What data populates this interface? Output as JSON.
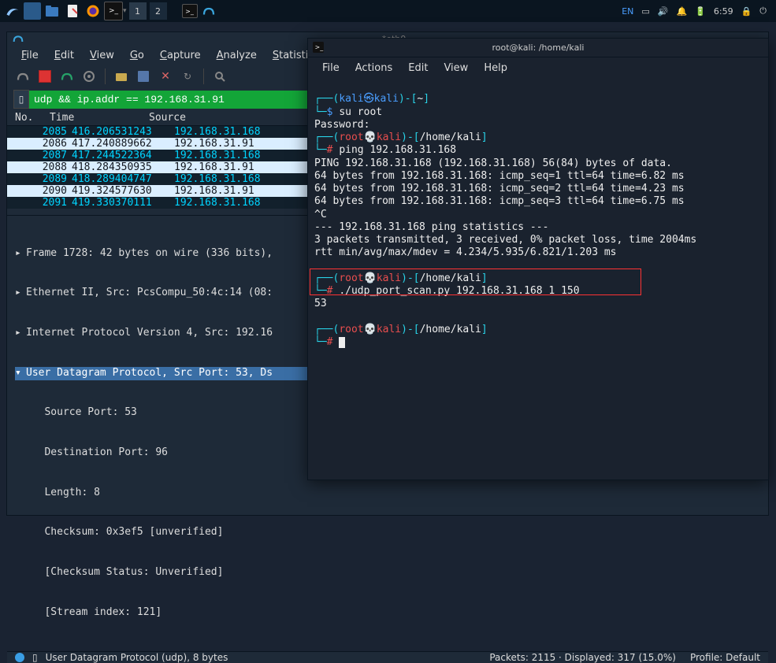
{
  "taskbar": {
    "workspaces": [
      "1",
      "2"
    ],
    "lang": "EN",
    "time": "6:59"
  },
  "wireshark": {
    "interface_title": "*eth0",
    "menu": [
      "File",
      "Edit",
      "View",
      "Go",
      "Capture",
      "Analyze",
      "Statistics"
    ],
    "filter": "udp && ip.addr == 192.168.31.91",
    "columns": {
      "no": "No.",
      "time": "Time",
      "source": "Source"
    },
    "rows": [
      {
        "no": "2085",
        "time": "416.206531243",
        "src": "192.168.31.168",
        "cls": "row-dark"
      },
      {
        "no": "2086",
        "time": "417.240889662",
        "src": "192.168.31.91",
        "cls": "row-light"
      },
      {
        "no": "2087",
        "time": "417.244522364",
        "src": "192.168.31.168",
        "cls": "row-dark"
      },
      {
        "no": "2088",
        "time": "418.284350935",
        "src": "192.168.31.91",
        "cls": "row-light"
      },
      {
        "no": "2089",
        "time": "418.289404747",
        "src": "192.168.31.168",
        "cls": "row-dark"
      },
      {
        "no": "2090",
        "time": "419.324577630",
        "src": "192.168.31.91",
        "cls": "row-light"
      },
      {
        "no": "2091",
        "time": "419.330370111",
        "src": "192.168.31.168",
        "cls": "row-dark"
      }
    ],
    "details": {
      "l0": "Frame 1728: 42 bytes on wire (336 bits),",
      "l1": "Ethernet II, Src: PcsCompu_50:4c:14 (08:",
      "l2": "Internet Protocol Version 4, Src: 192.16",
      "l3": "User Datagram Protocol, Src Port: 53, Ds",
      "l4": "   Source Port: 53",
      "l5": "   Destination Port: 96",
      "l6": "   Length: 8",
      "l7": "   Checksum: 0x3ef5 [unverified]",
      "l8": "   [Checksum Status: Unverified]",
      "l9": "   [Stream index: 121]"
    },
    "status": {
      "left": "User Datagram Protocol (udp), 8 bytes",
      "packets": "Packets: 2115 · Displayed: 317 (15.0%)",
      "profile": "Profile: Default"
    }
  },
  "terminal": {
    "title": "root@kali: /home/kali",
    "menu": [
      "File",
      "Actions",
      "Edit",
      "View",
      "Help"
    ],
    "prompt1_userhost": "kali㉿kali",
    "prompt1_path": "~",
    "cmd1": "su root",
    "password_label": "Password:",
    "prompt2_user": "root",
    "prompt2_host": "kali",
    "prompt2_path": "/home/kali",
    "cmd2": "ping 192.168.31.168",
    "ping_header": "PING 192.168.31.168 (192.168.31.168) 56(84) bytes of data.",
    "ping_l1": "64 bytes from 192.168.31.168: icmp_seq=1 ttl=64 time=6.82 ms",
    "ping_l2": "64 bytes from 192.168.31.168: icmp_seq=2 ttl=64 time=4.23 ms",
    "ping_l3": "64 bytes from 192.168.31.168: icmp_seq=3 ttl=64 time=6.75 ms",
    "ctrlc": "^C",
    "stats_header": "--- 192.168.31.168 ping statistics ---",
    "stats_l1": "3 packets transmitted, 3 received, 0% packet loss, time 2004ms",
    "stats_l2": "rtt min/avg/max/mdev = 4.234/5.935/6.821/1.203 ms",
    "cmd3": "./udp_port_scan.py 192.168.31.168 1 150",
    "cmd3_output": "53"
  }
}
